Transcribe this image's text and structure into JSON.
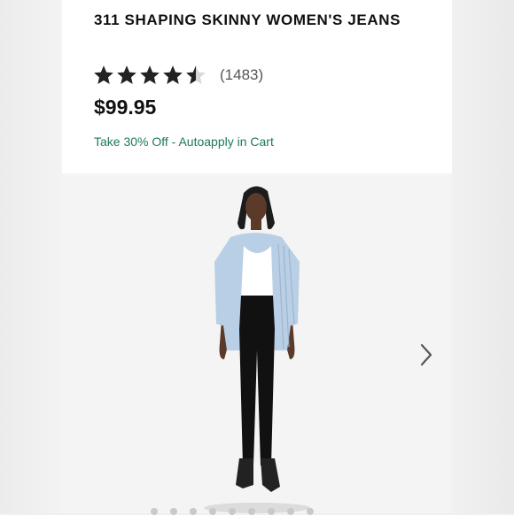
{
  "product": {
    "title": "311 SHAPING SKINNY WOMEN'S JEANS",
    "rating": 4.5,
    "review_count": "(1483)",
    "price": "$99.95",
    "promo": "Take 30% Off - Autoapply in Cart"
  },
  "colors": {
    "promo_text": "#1d7a55",
    "star": "#222222"
  },
  "gallery": {
    "image_description": "model-photo",
    "next_icon": "chevron-right-icon"
  }
}
